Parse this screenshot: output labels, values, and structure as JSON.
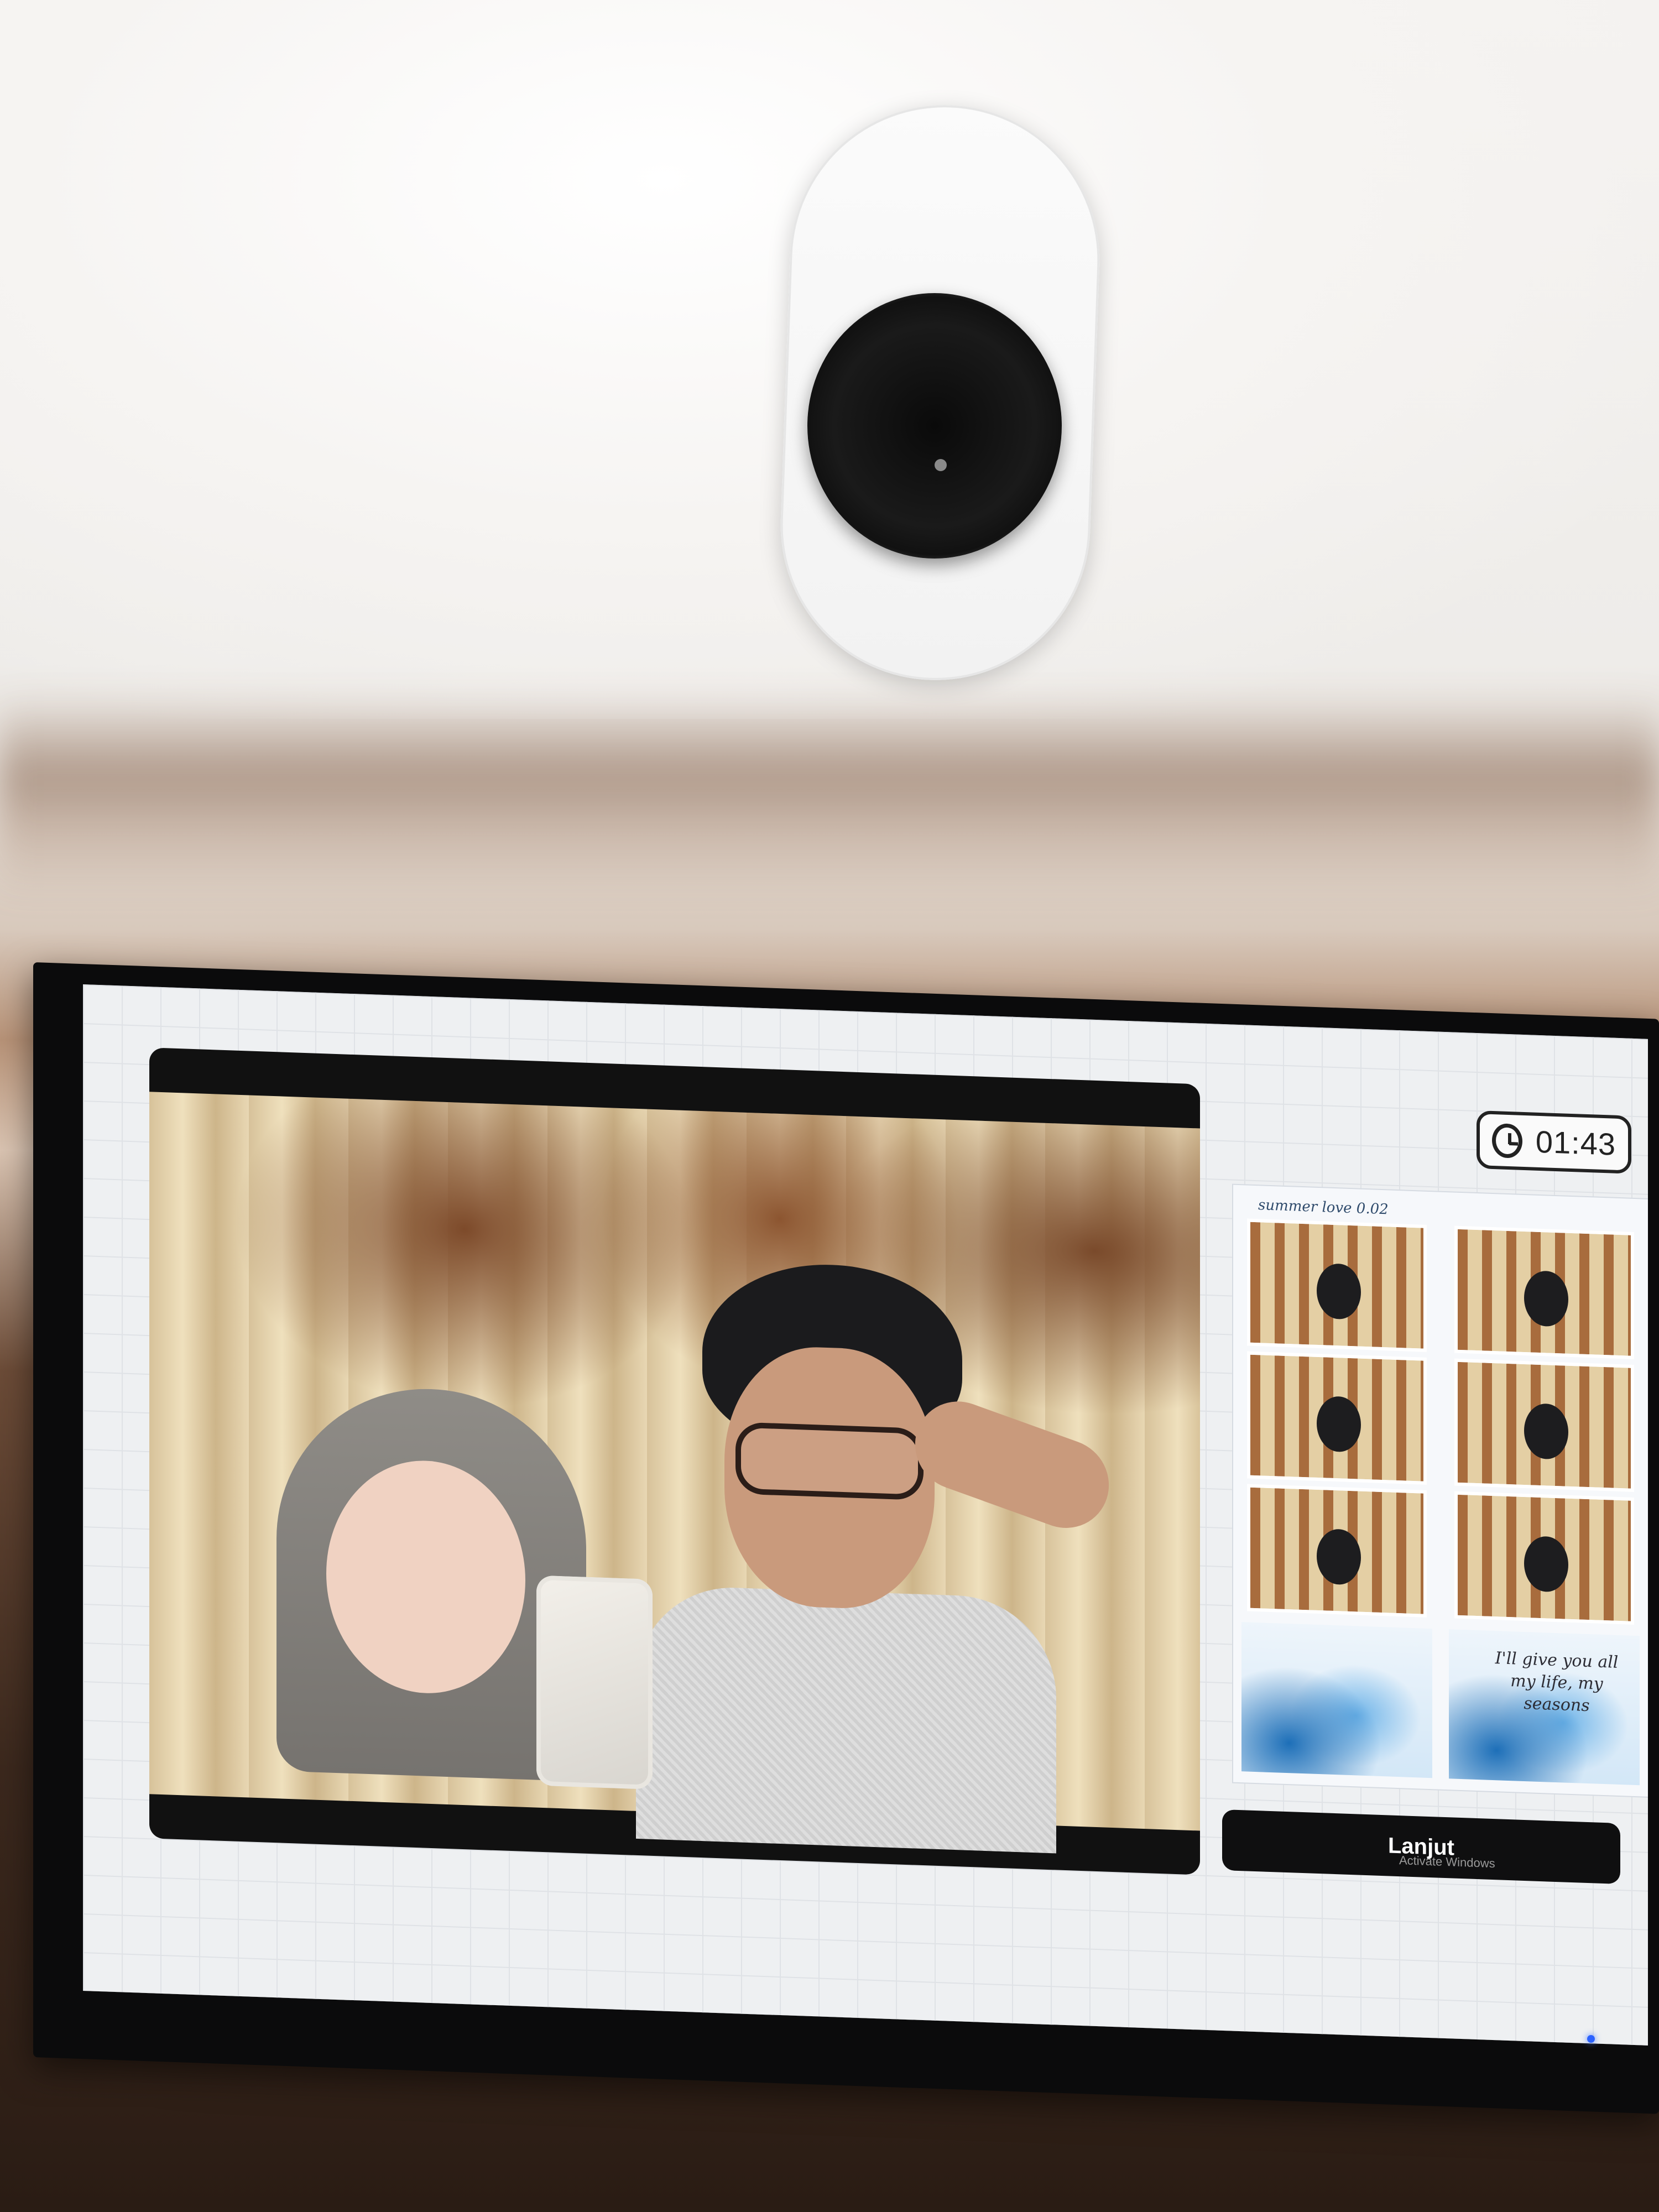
{
  "screen": {
    "timer": {
      "icon": "alarm-clock-icon",
      "text": "01:43"
    },
    "photostrip": {
      "caption": "summer love 0.02",
      "handwriting": "I'll give you all my life, my seasons"
    },
    "next_button": {
      "label": "Lanjut"
    },
    "os_watermark": "Activate Windows"
  },
  "colors": {
    "button_bg": "#0f0f10",
    "screen_bg": "#eef0f2",
    "led": "#2b62ff"
  }
}
